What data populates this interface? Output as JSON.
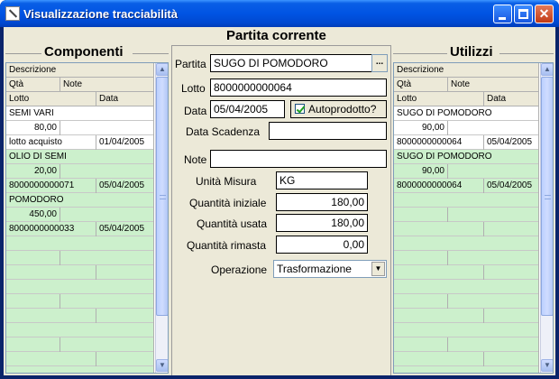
{
  "window": {
    "title": "Visualizzazione tracciabilità"
  },
  "icons": {
    "app": "trace-app-icon",
    "minimize": "minimize-icon",
    "maximize": "maximize-icon",
    "close": "close-icon",
    "scroll_up": "up-arrow-icon",
    "scroll_down": "down-arrow-icon",
    "dropdown": "dropdown-arrow-icon"
  },
  "colors": {
    "titlebar": "#0054e3",
    "row_highlight": "#ccf0cc",
    "close_button": "#c23a14"
  },
  "left_panel": {
    "title": "Componenti",
    "headers": {
      "descrizione": "Descrizione",
      "qta": "Qtà",
      "note": "Note",
      "lotto": "Lotto",
      "data": "Data"
    },
    "records": [
      {
        "descrizione": "SEMI VARI",
        "qta": "80,00",
        "note": "",
        "lotto": "lotto acquisto",
        "data": "01/04/2005"
      },
      {
        "descrizione": "OLIO DI SEMI",
        "qta": "20,00",
        "note": "",
        "lotto": "8000000000071",
        "data": "05/04/2005"
      },
      {
        "descrizione": "POMODORO",
        "qta": "450,00",
        "note": "",
        "lotto": "8000000000033",
        "data": "05/04/2005"
      }
    ]
  },
  "center_panel": {
    "title": "Partita corrente",
    "partita_label": "Partita",
    "partita_value": "SUGO DI POMODORO",
    "browse_label": "...",
    "lotto_label": "Lotto",
    "lotto_value": "8000000000064",
    "data_label": "Data",
    "data_value": "05/04/2005",
    "autoprodotto_label": "Autoprodotto?",
    "autoprodotto_checked": true,
    "data_scadenza_label": "Data Scadenza",
    "data_scadenza_value": "",
    "note_label": "Note",
    "note_value": "",
    "unita_label": "Unità Misura",
    "unita_value": "KG",
    "qta_iniziale_label": "Quantità iniziale",
    "qta_iniziale_value": "180,00",
    "qta_usata_label": "Quantità usata",
    "qta_usata_value": "180,00",
    "qta_rimasta_label": "Quantità rimasta",
    "qta_rimasta_value": "0,00",
    "operazione_label": "Operazione",
    "operazione_value": "Trasformazione"
  },
  "right_panel": {
    "title": "Utilizzi",
    "headers": {
      "descrizione": "Descrizione",
      "qta": "Qtà",
      "note": "Note",
      "lotto": "Lotto",
      "data": "Data"
    },
    "records": [
      {
        "descrizione": "SUGO DI POMODORO",
        "qta": "90,00",
        "note": "",
        "lotto": "8000000000064",
        "data": "05/04/2005"
      },
      {
        "descrizione": "SUGO DI POMODORO",
        "qta": "90,00",
        "note": "",
        "lotto": "8000000000064",
        "data": "05/04/2005"
      }
    ]
  }
}
